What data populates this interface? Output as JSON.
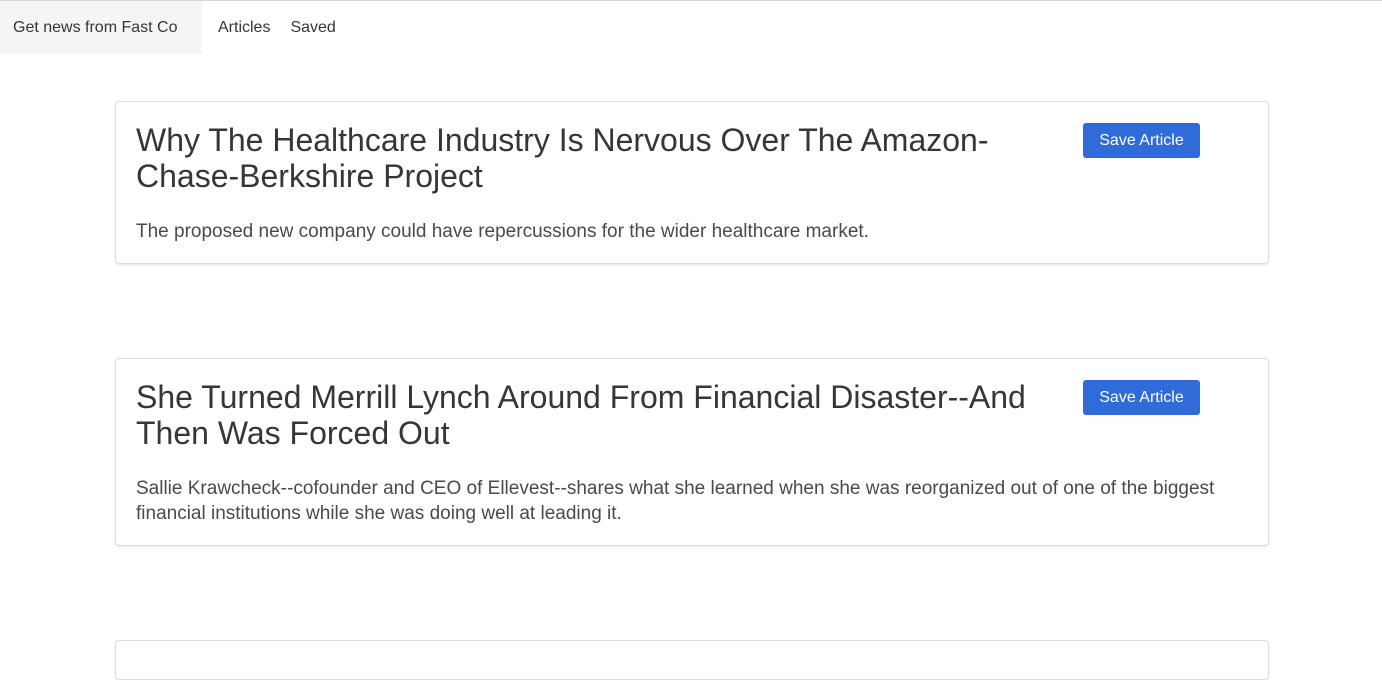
{
  "navbar": {
    "brand_label": "Get news from Fast Co",
    "articles_label": "Articles",
    "saved_label": "Saved"
  },
  "articles": [
    {
      "title": "Why The Healthcare Industry Is Nervous Over The Amazon-Chase-Berkshire Project",
      "summary": "The proposed new company could have repercussions for the wider healthcare market.",
      "button_label": "Save Article"
    },
    {
      "title": "She Turned Merrill Lynch Around From Financial Disaster--And Then Was Forced Out",
      "summary": "Sallie Krawcheck--cofounder and CEO of Ellevest--shares what she learned when she was reorganized out of one of the biggest financial institutions while she was doing well at leading it.",
      "button_label": "Save Article"
    }
  ],
  "colors": {
    "accent": "#2f6bd9",
    "brand_bg": "#f5f5f5",
    "text": "#363636"
  }
}
